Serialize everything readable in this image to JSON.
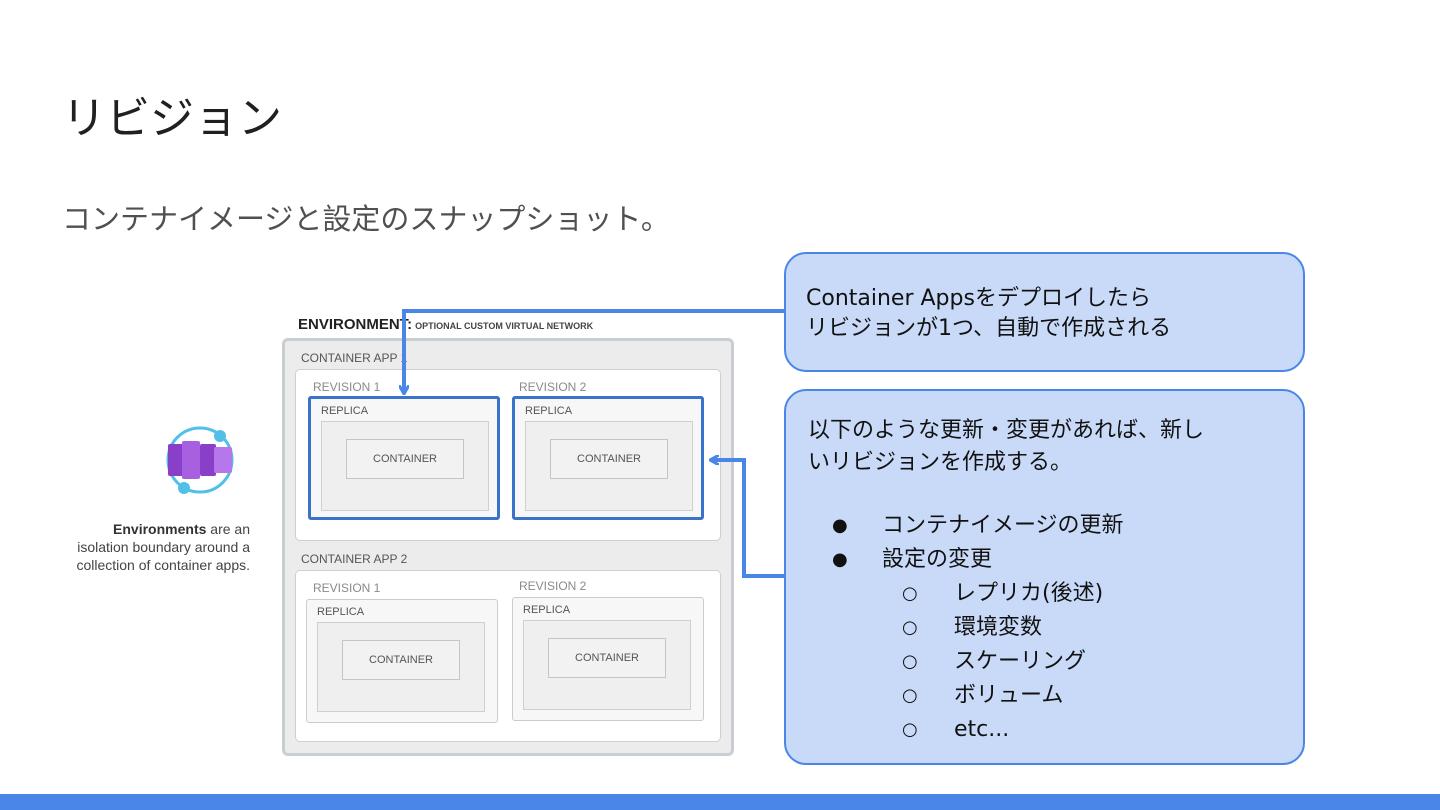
{
  "slide": {
    "title": "リビジョン",
    "subtitle": "コンテナイメージと設定のスナップショット。"
  },
  "environment_panel": {
    "icon": "container-apps-environment-icon",
    "caption_bold": "Environments",
    "caption_rest": " are an isolation boundary around a collection of container apps."
  },
  "diagram": {
    "environment_label": "ENVIRONMENT:",
    "environment_sublabel": "OPTIONAL CUSTOM VIRTUAL NETWORK",
    "apps": [
      {
        "label": "CONTAINER APP 1",
        "revisions": [
          {
            "label": "REVISION 1",
            "replica": "REPLICA",
            "container": "CONTAINER",
            "highlighted": true
          },
          {
            "label": "REVISION 2",
            "replica": "REPLICA",
            "container": "CONTAINER",
            "highlighted": true
          }
        ]
      },
      {
        "label": "CONTAINER APP 2",
        "revisions": [
          {
            "label": "REVISION 1",
            "replica": "REPLICA",
            "container": "CONTAINER",
            "highlighted": false
          },
          {
            "label": "REVISION 2",
            "replica": "REPLICA",
            "container": "CONTAINER",
            "highlighted": false
          }
        ]
      }
    ]
  },
  "callout_top": {
    "line1": "Container Appsをデプロイしたら",
    "line2": "リビジョンが1つ、自動で作成される"
  },
  "callout_bottom": {
    "para_line1": "以下のような更新・変更があれば、新し",
    "para_line2": "いリビジョンを作成する。",
    "bullets": [
      "コンテナイメージの更新",
      "設定の変更"
    ],
    "sub_bullets": [
      "レプリカ(後述)",
      "環境変数",
      "スケーリング",
      "ボリューム",
      "etc..."
    ],
    "bullet_mark": "●",
    "sub_bullet_mark": "○"
  },
  "colors": {
    "accent": "#4a86e8",
    "callout_fill": "#c9daf8",
    "highlight_border": "#3a73c9"
  }
}
